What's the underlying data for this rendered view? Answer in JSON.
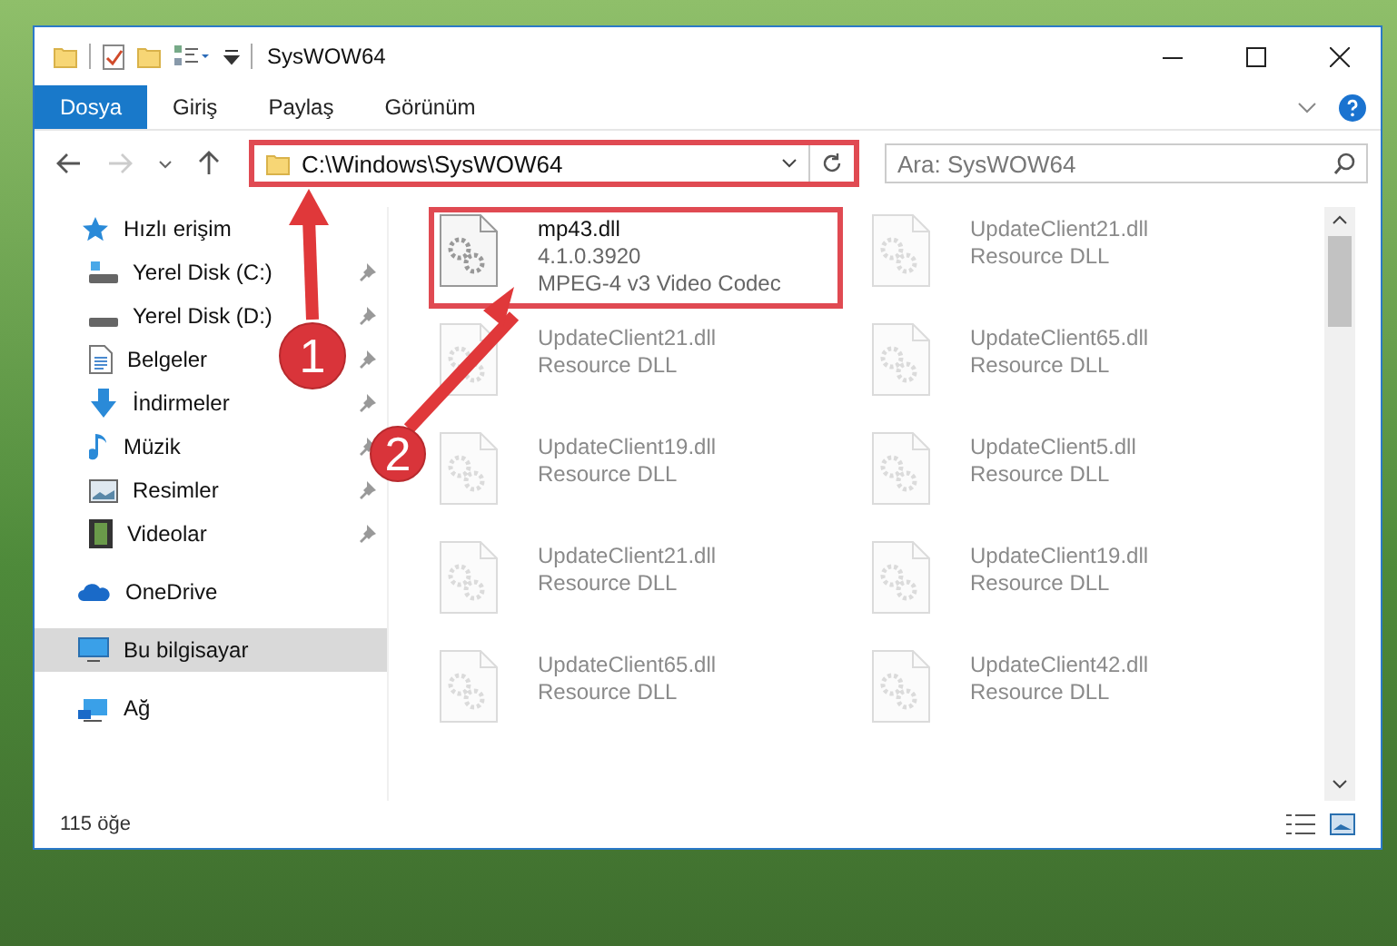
{
  "window": {
    "title": "SysWOW64"
  },
  "ribbon_tabs": [
    {
      "label": "Dosya",
      "selected": true
    },
    {
      "label": "Giriş",
      "selected": false
    },
    {
      "label": "Paylaş",
      "selected": false
    },
    {
      "label": "Görünüm",
      "selected": false
    }
  ],
  "address": {
    "path": "C:\\Windows\\SysWOW64",
    "highlighted": true
  },
  "search": {
    "placeholder": "Ara: SysWOW64"
  },
  "sidebar": {
    "items": [
      {
        "label": "Hızlı erişim",
        "kind": "star",
        "selected": false,
        "children": [
          {
            "label": "Yerel Disk (C:)",
            "kind": "drive-c",
            "pinned": true
          },
          {
            "label": "Yerel Disk (D:)",
            "kind": "drive",
            "pinned": true
          },
          {
            "label": "Belgeler",
            "kind": "doc",
            "pinned": true
          },
          {
            "label": "İndirmeler",
            "kind": "download",
            "pinned": true
          },
          {
            "label": "Müzik",
            "kind": "music",
            "pinned": true
          },
          {
            "label": "Resimler",
            "kind": "picture",
            "pinned": true
          },
          {
            "label": "Videolar",
            "kind": "video",
            "pinned": true
          }
        ]
      },
      {
        "label": "OneDrive",
        "kind": "cloud",
        "selected": false
      },
      {
        "label": "Bu bilgisayar",
        "kind": "pc",
        "selected": true
      },
      {
        "label": "Ağ",
        "kind": "network",
        "selected": false
      }
    ]
  },
  "files": [
    {
      "name": "mp43.dll",
      "details": [
        "4.1.0.3920",
        "MPEG-4 v3 Video Codec"
      ],
      "highlighted": true,
      "blurred": false
    },
    {
      "name": "UpdateClient21.dll",
      "details": [
        "Resource DLL"
      ],
      "highlighted": false,
      "blurred": true
    },
    {
      "name": "UpdateClient21.dll",
      "details": [
        "Resource DLL"
      ],
      "highlighted": false,
      "blurred": true
    },
    {
      "name": "UpdateClient65.dll",
      "details": [
        "Resource DLL"
      ],
      "highlighted": false,
      "blurred": true
    },
    {
      "name": "UpdateClient19.dll",
      "details": [
        "Resource DLL"
      ],
      "highlighted": false,
      "blurred": true
    },
    {
      "name": "UpdateClient5.dll",
      "details": [
        "Resource DLL"
      ],
      "highlighted": false,
      "blurred": true
    },
    {
      "name": "UpdateClient21.dll",
      "details": [
        "Resource DLL"
      ],
      "highlighted": false,
      "blurred": true
    },
    {
      "name": "UpdateClient19.dll",
      "details": [
        "Resource DLL"
      ],
      "highlighted": false,
      "blurred": true
    },
    {
      "name": "UpdateClient65.dll",
      "details": [
        "Resource DLL"
      ],
      "highlighted": false,
      "blurred": true
    },
    {
      "name": "UpdateClient42.dll",
      "details": [
        "Resource DLL"
      ],
      "highlighted": false,
      "blurred": true
    }
  ],
  "status_bar": {
    "count": "115 öğe"
  },
  "callouts": [
    {
      "label": "1"
    },
    {
      "label": "2"
    }
  ]
}
